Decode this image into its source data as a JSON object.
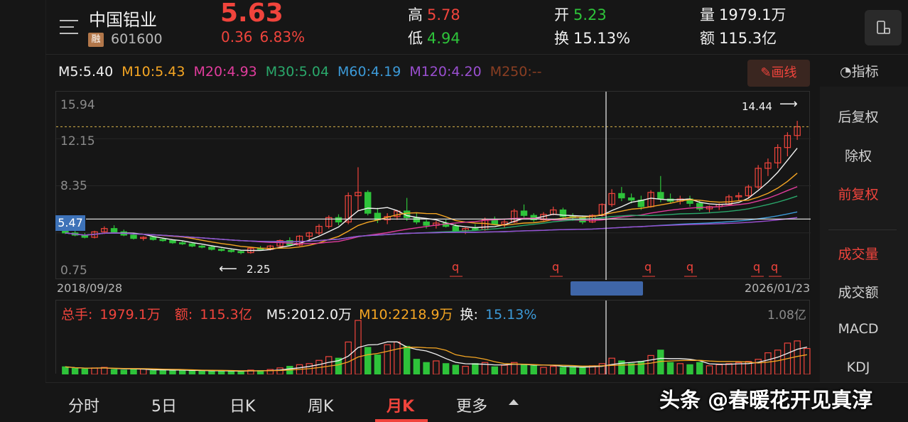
{
  "header": {
    "name": "中国铝业",
    "margin_badge": "融",
    "code": "601600",
    "price": "5.63",
    "change": "0.36",
    "change_pct": "6.83%",
    "high_label": "高",
    "high": "5.78",
    "low_label": "低",
    "low": "4.94",
    "open_label": "开",
    "open": "5.23",
    "turnover_label": "换",
    "turnover": "15.13%",
    "volume_label": "量",
    "volume": "1979.1万",
    "amount_label": "额",
    "amount": "115.3亿"
  },
  "ma_legend": [
    {
      "text": "M5:5.40",
      "color": "#f2f2f2"
    },
    {
      "text": "M10:5.43",
      "color": "#f5a623"
    },
    {
      "text": "M20:4.93",
      "color": "#e03c9c"
    },
    {
      "text": "M30:5.04",
      "color": "#2aa86b"
    },
    {
      "text": "M60:4.19",
      "color": "#3c9ad8"
    },
    {
      "text": "M120:4.20",
      "color": "#9a4fd0"
    },
    {
      "text": "M250:--",
      "color": "#8a3e22"
    }
  ],
  "toolbar": {
    "draw_label": "画线",
    "indicator_label": "指标"
  },
  "axis": {
    "y_labels": [
      "15.94",
      "12.15",
      "8.35",
      "0.75"
    ],
    "cursor_price": "5.47",
    "date_start": "2018/09/28",
    "date_end": "2026/01/23",
    "high_mark": "14.44",
    "low_mark": "2.25"
  },
  "volume_legend": {
    "total_label": "总手:",
    "total": "1979.1万",
    "amount_label": "额:",
    "amount": "115.3亿",
    "m5": "M5:2012.0万",
    "m10": "M10:2218.9万",
    "turnover_label": "换:",
    "turnover": "15.13%",
    "max": "1.08亿"
  },
  "right_panel": {
    "items": [
      {
        "label": "后复权",
        "active": false
      },
      {
        "label": "除权",
        "active": false
      },
      {
        "label": "前复权",
        "active": true
      },
      {
        "label": "成交量",
        "active": true
      },
      {
        "label": "成交额",
        "active": false
      },
      {
        "label": "MACD",
        "active": false
      },
      {
        "label": "KDJ",
        "active": false
      }
    ]
  },
  "tabs": [
    {
      "label": "分时",
      "active": false
    },
    {
      "label": "5日",
      "active": false
    },
    {
      "label": "日K",
      "active": false
    },
    {
      "label": "周K",
      "active": false
    },
    {
      "label": "月K",
      "active": true
    },
    {
      "label": "更多",
      "active": false
    }
  ],
  "watermark": "头条 @春暖花开见真淳",
  "colors": {
    "up": "#f0443c",
    "down": "#2ec33a",
    "accent": "#f0443c"
  },
  "chart_data": {
    "type": "candlestick",
    "period": "monthly",
    "x_range": [
      "2018/09/28",
      "2026/01/23"
    ],
    "ylim": [
      0.75,
      15.94
    ],
    "candles": [
      {
        "o": 4.6,
        "h": 4.9,
        "l": 4.1,
        "c": 4.2
      },
      {
        "o": 4.2,
        "h": 4.4,
        "l": 3.9,
        "c": 4.0
      },
      {
        "o": 4.0,
        "h": 4.2,
        "l": 3.7,
        "c": 3.8
      },
      {
        "o": 3.8,
        "h": 4.4,
        "l": 3.7,
        "c": 4.3
      },
      {
        "o": 4.3,
        "h": 4.8,
        "l": 4.1,
        "c": 4.6
      },
      {
        "o": 4.6,
        "h": 4.9,
        "l": 4.2,
        "c": 4.3
      },
      {
        "o": 4.3,
        "h": 4.5,
        "l": 3.9,
        "c": 4.0
      },
      {
        "o": 4.0,
        "h": 4.1,
        "l": 3.6,
        "c": 3.7
      },
      {
        "o": 3.7,
        "h": 3.9,
        "l": 3.5,
        "c": 3.8
      },
      {
        "o": 3.8,
        "h": 3.9,
        "l": 3.5,
        "c": 3.6
      },
      {
        "o": 3.6,
        "h": 3.7,
        "l": 3.4,
        "c": 3.5
      },
      {
        "o": 3.5,
        "h": 3.6,
        "l": 3.2,
        "c": 3.3
      },
      {
        "o": 3.3,
        "h": 3.5,
        "l": 3.1,
        "c": 3.2
      },
      {
        "o": 3.2,
        "h": 3.3,
        "l": 2.9,
        "c": 3.0
      },
      {
        "o": 3.0,
        "h": 3.1,
        "l": 2.8,
        "c": 2.9
      },
      {
        "o": 2.9,
        "h": 3.0,
        "l": 2.6,
        "c": 2.7
      },
      {
        "o": 2.7,
        "h": 2.8,
        "l": 2.5,
        "c": 2.6
      },
      {
        "o": 2.6,
        "h": 2.7,
        "l": 2.4,
        "c": 2.5
      },
      {
        "o": 2.5,
        "h": 2.6,
        "l": 2.25,
        "c": 2.4
      },
      {
        "o": 2.4,
        "h": 2.9,
        "l": 2.3,
        "c": 2.8
      },
      {
        "o": 2.8,
        "h": 3.0,
        "l": 2.6,
        "c": 2.7
      },
      {
        "o": 2.7,
        "h": 3.1,
        "l": 2.6,
        "c": 3.0
      },
      {
        "o": 3.0,
        "h": 3.6,
        "l": 2.9,
        "c": 3.5
      },
      {
        "o": 3.5,
        "h": 3.8,
        "l": 3.0,
        "c": 3.1
      },
      {
        "o": 3.1,
        "h": 4.0,
        "l": 3.0,
        "c": 3.9
      },
      {
        "o": 3.9,
        "h": 4.3,
        "l": 3.6,
        "c": 4.2
      },
      {
        "o": 4.2,
        "h": 5.0,
        "l": 4.0,
        "c": 4.8
      },
      {
        "o": 4.8,
        "h": 5.8,
        "l": 4.6,
        "c": 5.6
      },
      {
        "o": 5.6,
        "h": 5.9,
        "l": 4.9,
        "c": 5.2
      },
      {
        "o": 5.2,
        "h": 7.9,
        "l": 5.0,
        "c": 7.6
      },
      {
        "o": 7.6,
        "h": 10.2,
        "l": 6.2,
        "c": 7.9
      },
      {
        "o": 7.9,
        "h": 8.1,
        "l": 5.8,
        "c": 6.0
      },
      {
        "o": 6.0,
        "h": 6.5,
        "l": 5.1,
        "c": 5.4
      },
      {
        "o": 5.4,
        "h": 6.0,
        "l": 5.0,
        "c": 5.7
      },
      {
        "o": 5.7,
        "h": 6.3,
        "l": 5.4,
        "c": 6.2
      },
      {
        "o": 6.2,
        "h": 7.4,
        "l": 5.3,
        "c": 5.6
      },
      {
        "o": 5.6,
        "h": 6.0,
        "l": 5.0,
        "c": 5.2
      },
      {
        "o": 5.2,
        "h": 5.4,
        "l": 4.6,
        "c": 4.9
      },
      {
        "o": 4.9,
        "h": 5.3,
        "l": 4.6,
        "c": 5.1
      },
      {
        "o": 5.1,
        "h": 5.4,
        "l": 4.7,
        "c": 4.8
      },
      {
        "o": 4.8,
        "h": 5.0,
        "l": 4.3,
        "c": 4.4
      },
      {
        "o": 4.4,
        "h": 4.7,
        "l": 4.1,
        "c": 4.6
      },
      {
        "o": 4.6,
        "h": 5.0,
        "l": 4.4,
        "c": 4.5
      },
      {
        "o": 4.5,
        "h": 5.6,
        "l": 4.4,
        "c": 5.4
      },
      {
        "o": 5.4,
        "h": 5.7,
        "l": 4.9,
        "c": 5.0
      },
      {
        "o": 5.0,
        "h": 5.4,
        "l": 4.7,
        "c": 5.2
      },
      {
        "o": 5.2,
        "h": 6.4,
        "l": 5.1,
        "c": 6.2
      },
      {
        "o": 6.2,
        "h": 6.8,
        "l": 5.6,
        "c": 5.8
      },
      {
        "o": 5.8,
        "h": 6.0,
        "l": 5.2,
        "c": 5.4
      },
      {
        "o": 5.4,
        "h": 6.1,
        "l": 5.3,
        "c": 5.9
      },
      {
        "o": 5.9,
        "h": 6.6,
        "l": 5.8,
        "c": 6.3
      },
      {
        "o": 6.3,
        "h": 6.5,
        "l": 5.6,
        "c": 5.7
      },
      {
        "o": 5.7,
        "h": 6.0,
        "l": 5.3,
        "c": 5.6
      },
      {
        "o": 5.6,
        "h": 5.8,
        "l": 5.0,
        "c": 5.2
      },
      {
        "o": 5.2,
        "h": 5.9,
        "l": 5.1,
        "c": 5.8
      },
      {
        "o": 5.8,
        "h": 6.9,
        "l": 5.7,
        "c": 6.8
      },
      {
        "o": 6.8,
        "h": 8.2,
        "l": 6.6,
        "c": 7.8
      },
      {
        "o": 7.8,
        "h": 8.4,
        "l": 7.1,
        "c": 7.4
      },
      {
        "o": 7.4,
        "h": 7.8,
        "l": 6.9,
        "c": 7.2
      },
      {
        "o": 7.2,
        "h": 7.6,
        "l": 6.3,
        "c": 6.6
      },
      {
        "o": 6.6,
        "h": 8.1,
        "l": 6.5,
        "c": 7.9
      },
      {
        "o": 7.9,
        "h": 9.4,
        "l": 7.0,
        "c": 7.3
      },
      {
        "o": 7.3,
        "h": 7.8,
        "l": 6.9,
        "c": 7.1
      },
      {
        "o": 7.1,
        "h": 7.6,
        "l": 6.8,
        "c": 7.3
      },
      {
        "o": 7.3,
        "h": 7.6,
        "l": 6.6,
        "c": 6.9
      },
      {
        "o": 6.9,
        "h": 7.2,
        "l": 6.2,
        "c": 6.4
      },
      {
        "o": 6.4,
        "h": 6.7,
        "l": 6.0,
        "c": 6.6
      },
      {
        "o": 6.6,
        "h": 6.9,
        "l": 6.3,
        "c": 6.8
      },
      {
        "o": 6.8,
        "h": 7.7,
        "l": 6.7,
        "c": 7.5
      },
      {
        "o": 7.5,
        "h": 7.9,
        "l": 7.1,
        "c": 7.6
      },
      {
        "o": 7.6,
        "h": 8.6,
        "l": 7.4,
        "c": 8.4
      },
      {
        "o": 8.4,
        "h": 10.4,
        "l": 8.2,
        "c": 10.1
      },
      {
        "o": 10.1,
        "h": 11.0,
        "l": 9.4,
        "c": 10.6
      },
      {
        "o": 10.6,
        "h": 12.3,
        "l": 10.1,
        "c": 12.0
      },
      {
        "o": 12.0,
        "h": 13.4,
        "l": 11.2,
        "c": 13.1
      },
      {
        "o": 13.1,
        "h": 14.44,
        "l": 12.7,
        "c": 13.9
      }
    ],
    "volumes": [
      0.14,
      0.11,
      0.1,
      0.12,
      0.13,
      0.09,
      0.08,
      0.09,
      0.1,
      0.07,
      0.08,
      0.07,
      0.08,
      0.07,
      0.06,
      0.06,
      0.07,
      0.06,
      0.05,
      0.08,
      0.07,
      0.09,
      0.12,
      0.15,
      0.18,
      0.2,
      0.26,
      0.33,
      0.3,
      0.6,
      1.0,
      0.5,
      0.36,
      0.55,
      0.6,
      0.52,
      0.28,
      0.22,
      0.25,
      0.2,
      0.17,
      0.15,
      0.2,
      0.22,
      0.14,
      0.17,
      0.22,
      0.18,
      0.16,
      0.13,
      0.15,
      0.13,
      0.14,
      0.12,
      0.16,
      0.2,
      0.3,
      0.25,
      0.2,
      0.24,
      0.35,
      0.45,
      0.22,
      0.2,
      0.18,
      0.22,
      0.16,
      0.18,
      0.2,
      0.22,
      0.24,
      0.28,
      0.4,
      0.45,
      0.58,
      0.62,
      0.48
    ]
  }
}
